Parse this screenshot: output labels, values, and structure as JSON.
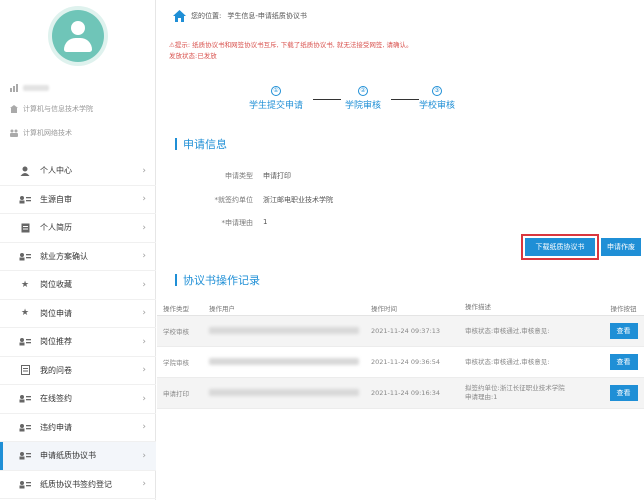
{
  "breadcrumb": {
    "prefix": "您的位置:",
    "path": "学生信息-申请纸质协议书"
  },
  "notice": {
    "line1": "⚠提示: 纸质协议书和网签协议书互斥, 下载了纸质协议书, 就无法接受网签, 请确认。",
    "line2": "发放状态:已发放"
  },
  "sidebar": {
    "info": [
      {
        "label": "计算机与信息技术学院",
        "icon": "building-icon"
      },
      {
        "label": "计算机网络技术",
        "icon": "group-icon"
      }
    ],
    "items": [
      {
        "label": "个人中心",
        "icon": "user-icon"
      },
      {
        "label": "生源自审",
        "icon": "id-card-icon"
      },
      {
        "label": "个人简历",
        "icon": "document-icon"
      },
      {
        "label": "就业方案确认",
        "icon": "id-card-icon"
      },
      {
        "label": "岗位收藏",
        "icon": "star-icon"
      },
      {
        "label": "岗位申请",
        "icon": "star-icon"
      },
      {
        "label": "岗位推荐",
        "icon": "id-card-icon"
      },
      {
        "label": "我的问卷",
        "icon": "list-icon"
      },
      {
        "label": "在线签约",
        "icon": "id-card-icon"
      },
      {
        "label": "违约申请",
        "icon": "id-card-icon"
      },
      {
        "label": "申请纸质协议书",
        "icon": "id-card-icon"
      },
      {
        "label": "纸质协议书签约登记",
        "icon": "id-card-icon"
      }
    ]
  },
  "steps": [
    {
      "num": "①",
      "label": "学生提交申请"
    },
    {
      "num": "②",
      "label": "学院审核"
    },
    {
      "num": "③",
      "label": "学校审核"
    }
  ],
  "apply_section": {
    "title": "申请信息",
    "fields": [
      {
        "label": "申请类型",
        "value": "申请打印"
      },
      {
        "label": "*就签约单位",
        "value": "浙江邮电职业技术学院"
      },
      {
        "label": "*申请理由",
        "value": "1"
      }
    ],
    "download_label": "下载纸质协议书",
    "apply_label": "申请作废"
  },
  "record_section": {
    "title": "协议书操作记录",
    "headers": [
      "操作类型",
      "操作用户",
      "操作时间",
      "操作描述",
      "操作按钮"
    ],
    "rows": [
      {
        "type": "学校审核",
        "time": "2021-11-24 09:37:13",
        "desc1": "审核状态:审核通过,审核意见:",
        "desc2": "",
        "btn": "查看"
      },
      {
        "type": "学院审核",
        "time": "2021-11-24 09:36:54",
        "desc1": "审核状态:审核通过,审核意见:",
        "desc2": "",
        "btn": "查看"
      },
      {
        "type": "申请打印",
        "time": "2021-11-24 09:16:34",
        "desc1": "拟签约单位:浙江长征职业技术学院",
        "desc2": "申请理由:1",
        "btn": "查看"
      }
    ]
  },
  "colors": {
    "accent": "#1f8fd6",
    "warning": "#d9534f",
    "avatar": "#6fc5b8"
  }
}
